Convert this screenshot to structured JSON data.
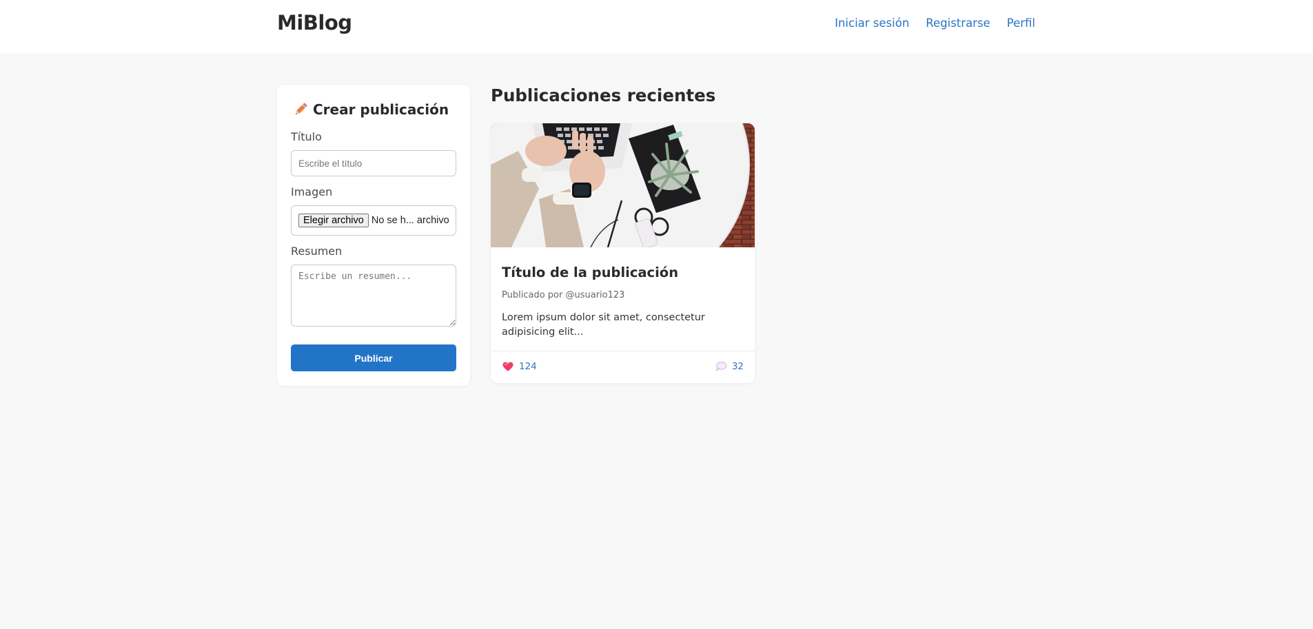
{
  "header": {
    "brand": "MiBlog",
    "nav": [
      {
        "label": "Iniciar sesión"
      },
      {
        "label": "Registrarse"
      },
      {
        "label": "Perfil"
      }
    ]
  },
  "create_post": {
    "title": "Crear publicación",
    "title_icon": "pencil-icon",
    "fields": {
      "title_label": "Título",
      "title_placeholder": "Escribe el título",
      "image_label": "Imagen",
      "file_button": "Elegir archivo",
      "file_status": "No se h... archivo",
      "summary_label": "Resumen",
      "summary_placeholder": "Escribe un resumen..."
    },
    "submit_label": "Publicar"
  },
  "feed": {
    "heading": "Publicaciones recientes",
    "posts": [
      {
        "image_icon": "desk-workspace-photo",
        "title": "Título de la publicación",
        "meta": "Publicado por @usuario123",
        "summary": "Lorem ipsum dolor sit amet, consectetur adipisicing elit...",
        "likes": "124",
        "likes_icon": "heart-icon",
        "comments": "32",
        "comments_icon": "speech-bubble-icon"
      }
    ]
  },
  "colors": {
    "accent": "#2274c9",
    "link": "#2a74c6",
    "background": "#f8f8f8",
    "card": "#ffffff",
    "text": "#2a2a2a"
  }
}
